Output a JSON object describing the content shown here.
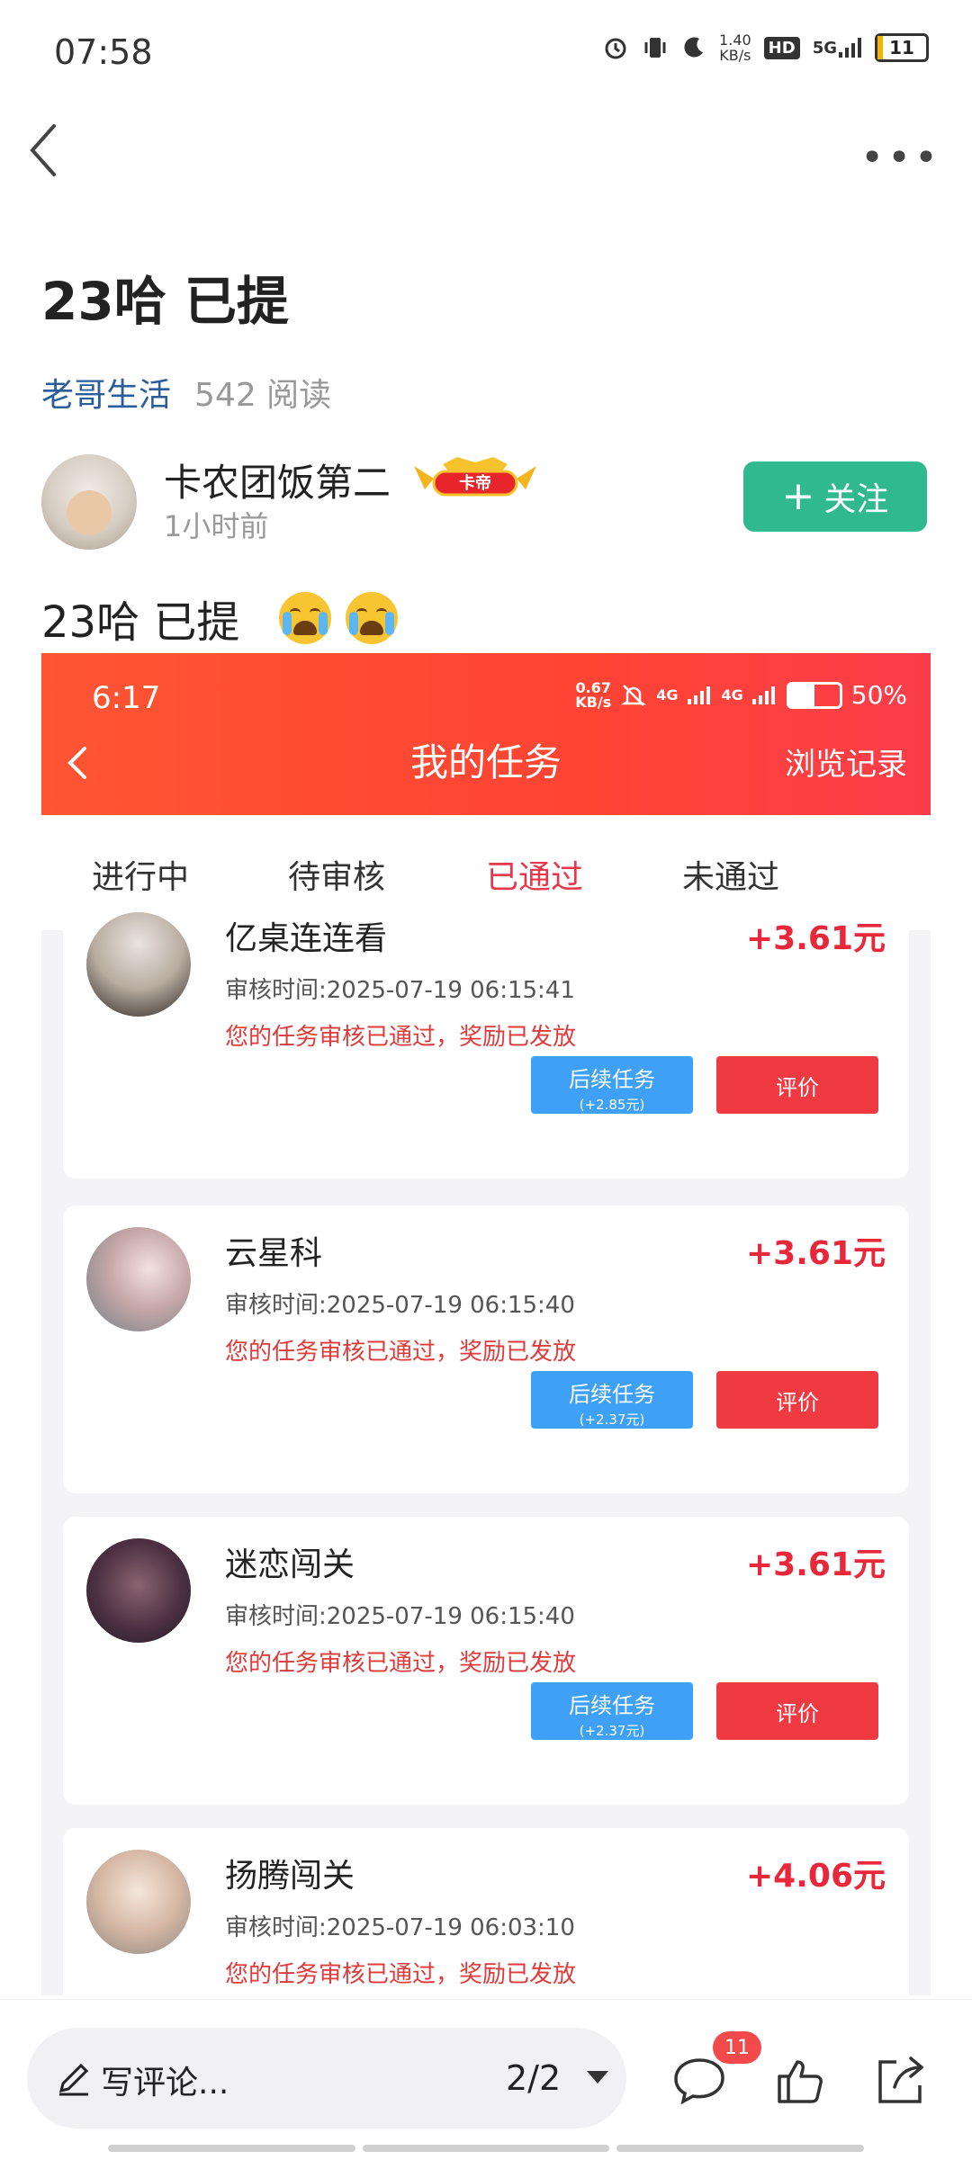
{
  "status_bar": {
    "time": "07:58",
    "speed_top": "1.40",
    "speed_bottom": "KB/s",
    "hd": "HD",
    "network": "5G",
    "battery": "11"
  },
  "post": {
    "title": "23哈 已提",
    "channel": "老哥生活",
    "reads": "542 阅读",
    "author": "卡农团饭第二",
    "badge_text": "卡帝",
    "post_time": "1小时前",
    "follow_label": "关注",
    "body_text": "23哈  已提"
  },
  "embedded": {
    "status_time": "6:17",
    "speed_top": "0.67",
    "speed_bottom": "KB/s",
    "net_1": "4G",
    "net_2": "4G",
    "battery": "50%",
    "title": "我的任务",
    "history": "浏览记录",
    "tabs": [
      "进行中",
      "待审核",
      "已通过",
      "未通过"
    ],
    "active_tab": "已通过",
    "cards": [
      {
        "name": "亿桌连连看",
        "amount": "+3.61元",
        "time": "审核时间:2025-07-19 06:15:41",
        "message": "您的任务审核已通过，奖励已发放",
        "followup_label": "后续任务",
        "followup_bonus": "(+2.85元)",
        "rate_label": "评价"
      },
      {
        "name": "云星科",
        "amount": "+3.61元",
        "time": "审核时间:2025-07-19 06:15:40",
        "message": "您的任务审核已通过，奖励已发放",
        "followup_label": "后续任务",
        "followup_bonus": "(+2.37元)",
        "rate_label": "评价"
      },
      {
        "name": "迷恋闯关",
        "amount": "+3.61元",
        "time": "审核时间:2025-07-19 06:15:40",
        "message": "您的任务审核已通过，奖励已发放",
        "followup_label": "后续任务",
        "followup_bonus": "(+2.37元)",
        "rate_label": "评价"
      },
      {
        "name": "扬腾闯关",
        "amount": "+4.06元",
        "time": "审核时间:2025-07-19 06:03:10",
        "message": "您的任务审核已通过，奖励已发放"
      }
    ]
  },
  "bottom_bar": {
    "comment_placeholder": "写评论...",
    "page_indicator": "2/2",
    "comment_count": "11"
  },
  "colors": {
    "follow": "#2fb98c",
    "header_red": "#ff4433",
    "accent_red": "#e8374a",
    "followup_blue": "#3ea0f6",
    "rate_red": "#f03a42",
    "channel_blue": "#2a5d9c"
  }
}
